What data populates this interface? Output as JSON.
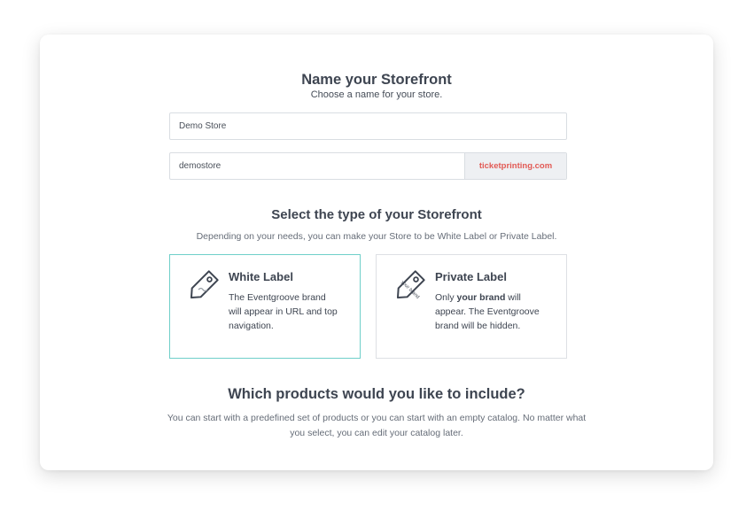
{
  "storefront": {
    "title": "Name your Storefront",
    "subtitle": "Choose a name for your store.",
    "store_name_value": "Demo Store",
    "slug_value": "demostore",
    "domain_suffix": "ticketprinting.com"
  },
  "type_section": {
    "title": "Select the type of your Storefront",
    "subtitle": "Depending on your needs, you can make your Store to be White Label or Private Label.",
    "options": [
      {
        "title": "White Label",
        "icon": "tag-icon",
        "desc_line1": "The Eventgroove brand",
        "desc_line2": "will appear in URL and top",
        "desc_line3": "navigation.",
        "selected": true
      },
      {
        "title": "Private Label",
        "icon": "tag-your-brand-icon",
        "icon_text": "your brand",
        "desc_prefix": "Only ",
        "desc_bold": "your brand",
        "desc_suffix": " will",
        "desc_line2": "appear. The Eventgroove",
        "desc_line3": "brand will be hidden.",
        "selected": false
      }
    ]
  },
  "products_section": {
    "title": "Which products would you like to include?",
    "subtitle": "You can start with a predefined set of products or you can start with an empty catalog. No matter what you select, you can edit your catalog later."
  },
  "colors": {
    "accent_teal": "#6fcfc9",
    "suffix_red": "#e25a55",
    "text_dark": "#3e4551"
  }
}
